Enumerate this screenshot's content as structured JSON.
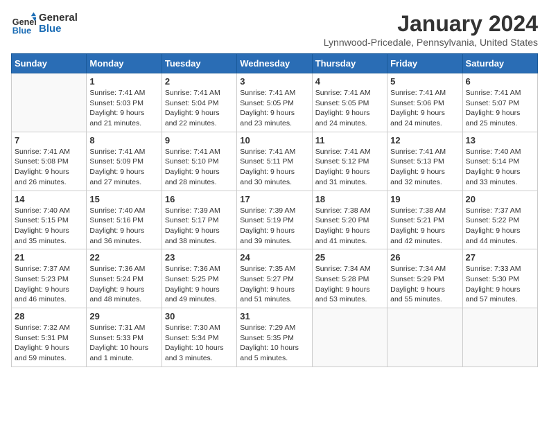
{
  "logo": {
    "line1": "General",
    "line2": "Blue"
  },
  "title": "January 2024",
  "subtitle": "Lynnwood-Pricedale, Pennsylvania, United States",
  "days_header": [
    "Sunday",
    "Monday",
    "Tuesday",
    "Wednesday",
    "Thursday",
    "Friday",
    "Saturday"
  ],
  "weeks": [
    [
      {
        "num": "",
        "info": ""
      },
      {
        "num": "1",
        "info": "Sunrise: 7:41 AM\nSunset: 5:03 PM\nDaylight: 9 hours\nand 21 minutes."
      },
      {
        "num": "2",
        "info": "Sunrise: 7:41 AM\nSunset: 5:04 PM\nDaylight: 9 hours\nand 22 minutes."
      },
      {
        "num": "3",
        "info": "Sunrise: 7:41 AM\nSunset: 5:05 PM\nDaylight: 9 hours\nand 23 minutes."
      },
      {
        "num": "4",
        "info": "Sunrise: 7:41 AM\nSunset: 5:05 PM\nDaylight: 9 hours\nand 24 minutes."
      },
      {
        "num": "5",
        "info": "Sunrise: 7:41 AM\nSunset: 5:06 PM\nDaylight: 9 hours\nand 24 minutes."
      },
      {
        "num": "6",
        "info": "Sunrise: 7:41 AM\nSunset: 5:07 PM\nDaylight: 9 hours\nand 25 minutes."
      }
    ],
    [
      {
        "num": "7",
        "info": "Sunrise: 7:41 AM\nSunset: 5:08 PM\nDaylight: 9 hours\nand 26 minutes."
      },
      {
        "num": "8",
        "info": "Sunrise: 7:41 AM\nSunset: 5:09 PM\nDaylight: 9 hours\nand 27 minutes."
      },
      {
        "num": "9",
        "info": "Sunrise: 7:41 AM\nSunset: 5:10 PM\nDaylight: 9 hours\nand 28 minutes."
      },
      {
        "num": "10",
        "info": "Sunrise: 7:41 AM\nSunset: 5:11 PM\nDaylight: 9 hours\nand 30 minutes."
      },
      {
        "num": "11",
        "info": "Sunrise: 7:41 AM\nSunset: 5:12 PM\nDaylight: 9 hours\nand 31 minutes."
      },
      {
        "num": "12",
        "info": "Sunrise: 7:41 AM\nSunset: 5:13 PM\nDaylight: 9 hours\nand 32 minutes."
      },
      {
        "num": "13",
        "info": "Sunrise: 7:40 AM\nSunset: 5:14 PM\nDaylight: 9 hours\nand 33 minutes."
      }
    ],
    [
      {
        "num": "14",
        "info": "Sunrise: 7:40 AM\nSunset: 5:15 PM\nDaylight: 9 hours\nand 35 minutes."
      },
      {
        "num": "15",
        "info": "Sunrise: 7:40 AM\nSunset: 5:16 PM\nDaylight: 9 hours\nand 36 minutes."
      },
      {
        "num": "16",
        "info": "Sunrise: 7:39 AM\nSunset: 5:17 PM\nDaylight: 9 hours\nand 38 minutes."
      },
      {
        "num": "17",
        "info": "Sunrise: 7:39 AM\nSunset: 5:19 PM\nDaylight: 9 hours\nand 39 minutes."
      },
      {
        "num": "18",
        "info": "Sunrise: 7:38 AM\nSunset: 5:20 PM\nDaylight: 9 hours\nand 41 minutes."
      },
      {
        "num": "19",
        "info": "Sunrise: 7:38 AM\nSunset: 5:21 PM\nDaylight: 9 hours\nand 42 minutes."
      },
      {
        "num": "20",
        "info": "Sunrise: 7:37 AM\nSunset: 5:22 PM\nDaylight: 9 hours\nand 44 minutes."
      }
    ],
    [
      {
        "num": "21",
        "info": "Sunrise: 7:37 AM\nSunset: 5:23 PM\nDaylight: 9 hours\nand 46 minutes."
      },
      {
        "num": "22",
        "info": "Sunrise: 7:36 AM\nSunset: 5:24 PM\nDaylight: 9 hours\nand 48 minutes."
      },
      {
        "num": "23",
        "info": "Sunrise: 7:36 AM\nSunset: 5:25 PM\nDaylight: 9 hours\nand 49 minutes."
      },
      {
        "num": "24",
        "info": "Sunrise: 7:35 AM\nSunset: 5:27 PM\nDaylight: 9 hours\nand 51 minutes."
      },
      {
        "num": "25",
        "info": "Sunrise: 7:34 AM\nSunset: 5:28 PM\nDaylight: 9 hours\nand 53 minutes."
      },
      {
        "num": "26",
        "info": "Sunrise: 7:34 AM\nSunset: 5:29 PM\nDaylight: 9 hours\nand 55 minutes."
      },
      {
        "num": "27",
        "info": "Sunrise: 7:33 AM\nSunset: 5:30 PM\nDaylight: 9 hours\nand 57 minutes."
      }
    ],
    [
      {
        "num": "28",
        "info": "Sunrise: 7:32 AM\nSunset: 5:31 PM\nDaylight: 9 hours\nand 59 minutes."
      },
      {
        "num": "29",
        "info": "Sunrise: 7:31 AM\nSunset: 5:33 PM\nDaylight: 10 hours\nand 1 minute."
      },
      {
        "num": "30",
        "info": "Sunrise: 7:30 AM\nSunset: 5:34 PM\nDaylight: 10 hours\nand 3 minutes."
      },
      {
        "num": "31",
        "info": "Sunrise: 7:29 AM\nSunset: 5:35 PM\nDaylight: 10 hours\nand 5 minutes."
      },
      {
        "num": "",
        "info": ""
      },
      {
        "num": "",
        "info": ""
      },
      {
        "num": "",
        "info": ""
      }
    ]
  ]
}
